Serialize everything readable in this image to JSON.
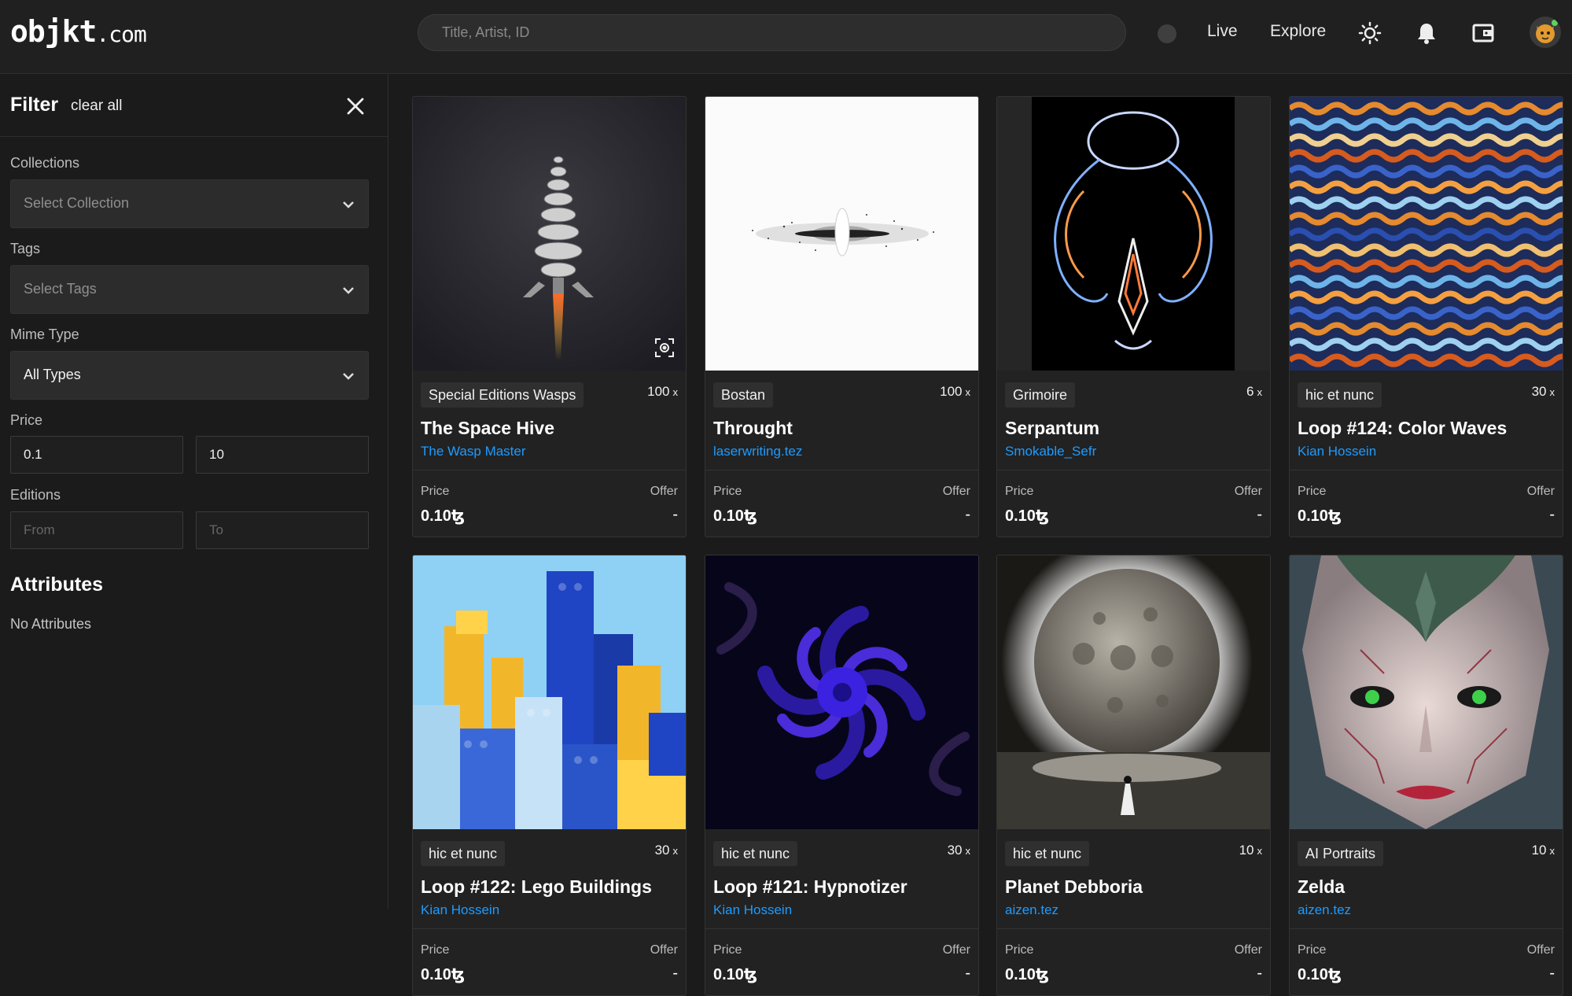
{
  "header": {
    "logo_main": "objkt",
    "logo_suffix": ".com",
    "search_placeholder": "Title, Artist, ID",
    "nav": [
      "Live",
      "Explore"
    ]
  },
  "sidebar": {
    "filter_title": "Filter",
    "clear_all": "clear all",
    "collections_label": "Collections",
    "collections_placeholder": "Select Collection",
    "tags_label": "Tags",
    "tags_placeholder": "Select Tags",
    "mime_label": "Mime Type",
    "mime_value": "All Types",
    "price_label": "Price",
    "price_min": "0.1",
    "price_max": "10",
    "editions_label": "Editions",
    "editions_from_placeholder": "From",
    "editions_to_placeholder": "To",
    "attributes_title": "Attributes",
    "attributes_empty": "No Attributes"
  },
  "cards": [
    {
      "collection": "Special Editions Wasps",
      "editions": "100",
      "editions_x": "x",
      "title": "The Space Hive",
      "artist": "The Wasp Master",
      "price_label": "Price",
      "price": "0.10ꜩ",
      "offer_label": "Offer",
      "offer": "-"
    },
    {
      "collection": "Bostan",
      "editions": "100",
      "editions_x": "x",
      "title": "Throught",
      "artist": "laserwriting.tez",
      "price_label": "Price",
      "price": "0.10ꜩ",
      "offer_label": "Offer",
      "offer": "-"
    },
    {
      "collection": "Grimoire",
      "editions": "6",
      "editions_x": "x",
      "title": "Serpantum",
      "artist": "Smokable_Sefr",
      "price_label": "Price",
      "price": "0.10ꜩ",
      "offer_label": "Offer",
      "offer": "-"
    },
    {
      "collection": "hic et nunc",
      "editions": "30",
      "editions_x": "x",
      "title": "Loop #124: Color Waves",
      "artist": "Kian Hossein",
      "price_label": "Price",
      "price": "0.10ꜩ",
      "offer_label": "Offer",
      "offer": "-"
    },
    {
      "collection": "hic et nunc",
      "editions": "30",
      "editions_x": "x",
      "title": "Loop #122: Lego Buildings",
      "artist": "Kian Hossein",
      "price_label": "Price",
      "price": "0.10ꜩ",
      "offer_label": "Offer",
      "offer": "-"
    },
    {
      "collection": "hic et nunc",
      "editions": "30",
      "editions_x": "x",
      "title": "Loop #121: Hypnotizer",
      "artist": "Kian Hossein",
      "price_label": "Price",
      "price": "0.10ꜩ",
      "offer_label": "Offer",
      "offer": "-"
    },
    {
      "collection": "hic et nunc",
      "editions": "10",
      "editions_x": "x",
      "title": "Planet Debboria",
      "artist": "aizen.tez",
      "price_label": "Price",
      "price": "0.10ꜩ",
      "offer_label": "Offer",
      "offer": "-"
    },
    {
      "collection": "AI Portraits",
      "editions": "10",
      "editions_x": "x",
      "title": "Zelda",
      "artist": "aizen.tez",
      "price_label": "Price",
      "price": "0.10ꜩ",
      "offer_label": "Offer",
      "offer": "-"
    }
  ],
  "colors": {
    "accent_link": "#1e9bff",
    "background": "#1b1b1b",
    "card": "#222222"
  }
}
